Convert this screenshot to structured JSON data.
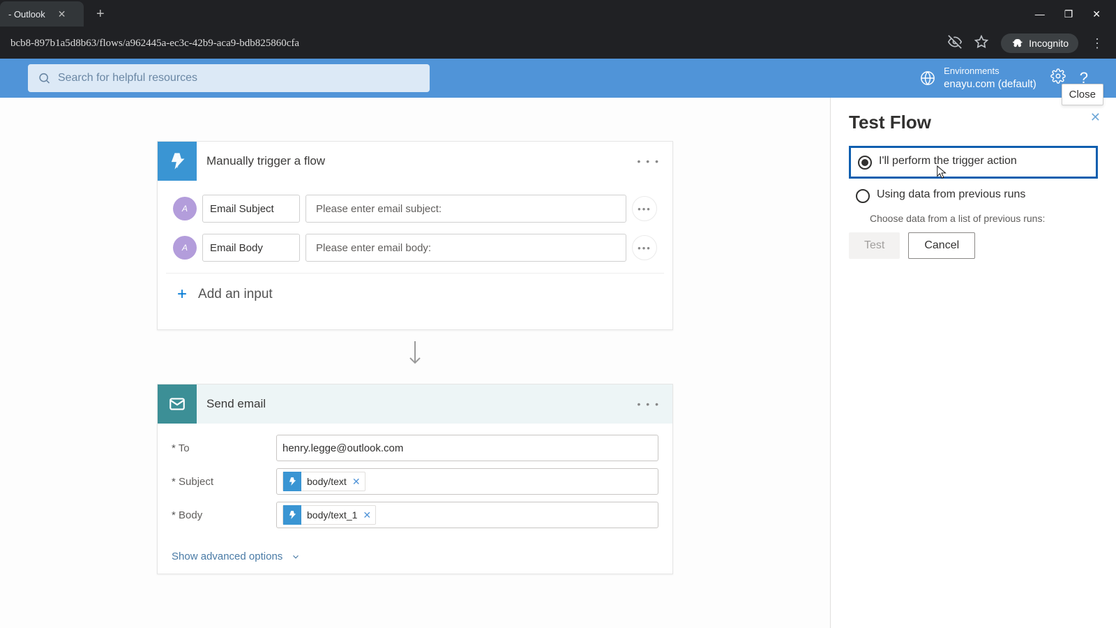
{
  "browser": {
    "tab_title": "- Outlook",
    "url": "bcb8-897b1a5d8b63/flows/a962445a-ec3c-42b9-aca9-bdb825860cfa",
    "incognito_label": "Incognito"
  },
  "header": {
    "search_placeholder": "Search for helpful resources",
    "env_label": "Environments",
    "env_value": "enayu.com (default)"
  },
  "trigger_card": {
    "title": "Manually trigger a flow",
    "rows": [
      {
        "name": "Email Subject",
        "value": "Please enter email subject:"
      },
      {
        "name": "Email Body",
        "value": "Please enter email body:"
      }
    ],
    "add_input": "Add an input"
  },
  "action_card": {
    "title": "Send email",
    "to_label": "To",
    "to_value": "henry.legge@outlook.com",
    "subject_label": "Subject",
    "subject_token": "body/text",
    "body_label": "Body",
    "body_token": "body/text_1",
    "show_advanced": "Show advanced options"
  },
  "panel": {
    "close_tip": "Close",
    "title": "Test Flow",
    "option1": "I'll perform the trigger action",
    "option2": "Using data from previous runs",
    "option2_sub": "Choose data from a list of previous runs:",
    "test_btn": "Test",
    "cancel_btn": "Cancel"
  }
}
